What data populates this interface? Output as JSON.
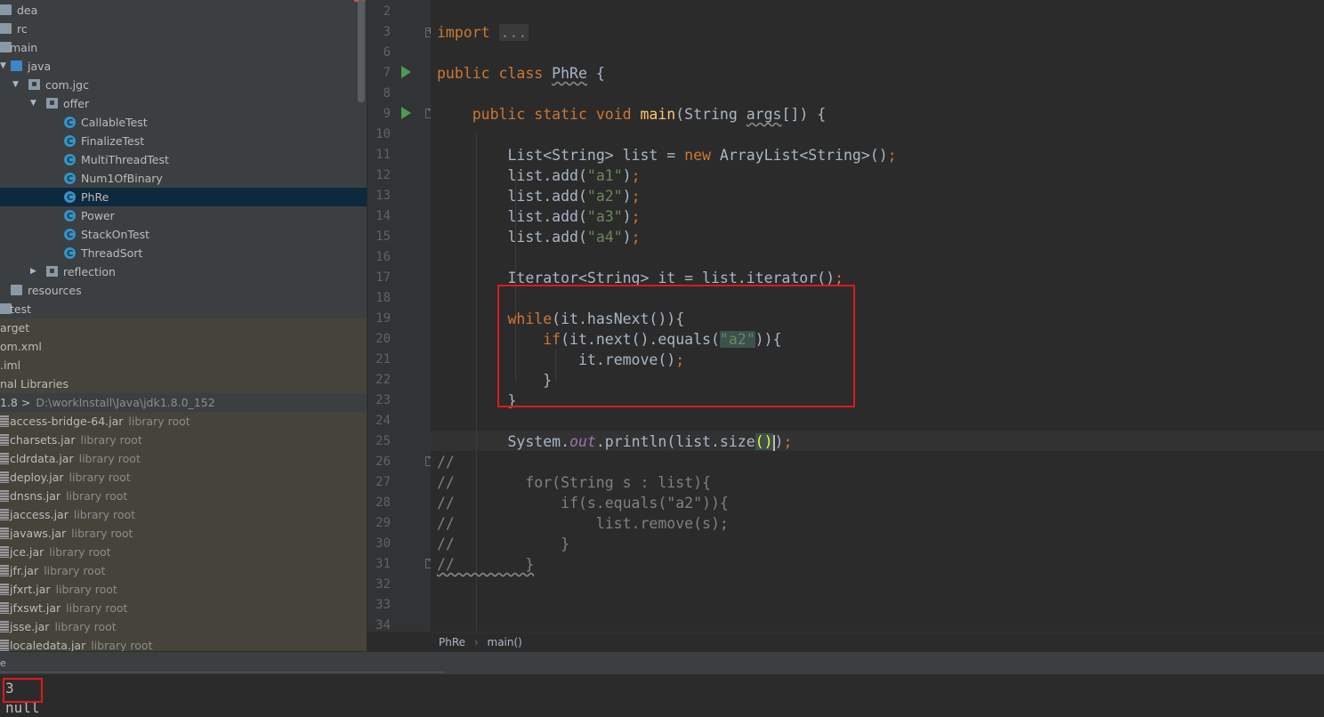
{
  "project_tree": {
    "items": [
      {
        "label": "dea",
        "icon": "folder-icon",
        "arrow": "",
        "indent": 0
      },
      {
        "label": "rc",
        "icon": "folder-icon",
        "arrow": "",
        "indent": 0
      },
      {
        "label": "main",
        "icon": "folder-icon",
        "arrow": "",
        "indent": 1
      },
      {
        "label": "java",
        "icon": "folder-icon",
        "arrow": "expanded",
        "indent": 2
      },
      {
        "label": "com.jgc",
        "icon": "package-icon",
        "arrow": "expanded",
        "indent": 3
      },
      {
        "label": "offer",
        "icon": "package-icon",
        "arrow": "expanded",
        "indent": 4
      },
      {
        "label": "CallableTest",
        "icon": "class-icon",
        "arrow": "",
        "indent": 5
      },
      {
        "label": "FinalizeTest",
        "icon": "class-icon",
        "arrow": "",
        "indent": 5
      },
      {
        "label": "MultiThreadTest",
        "icon": "class-icon",
        "arrow": "",
        "indent": 5
      },
      {
        "label": "Num1OfBinary",
        "icon": "class-icon",
        "arrow": "",
        "indent": 5
      },
      {
        "label": "PhRe",
        "icon": "class-icon",
        "arrow": "",
        "indent": 5
      },
      {
        "label": "Power",
        "icon": "class-icon",
        "arrow": "",
        "indent": 5
      },
      {
        "label": "StackOnTest",
        "icon": "class-icon",
        "arrow": "",
        "indent": 5
      },
      {
        "label": "ThreadSort",
        "icon": "class-icon",
        "arrow": "",
        "indent": 5
      },
      {
        "label": "reflection",
        "icon": "package-icon",
        "arrow": "collapsed",
        "indent": 4
      },
      {
        "label": "resources",
        "icon": "folder-icon",
        "arrow": "",
        "indent": 2
      },
      {
        "label": "test",
        "icon": "folder-icon",
        "arrow": "",
        "indent": 1
      },
      {
        "label": "arget",
        "icon": "",
        "arrow": "",
        "indent": 0
      },
      {
        "label": "om.xml",
        "icon": "",
        "arrow": "",
        "indent": 0
      },
      {
        "label": ".iml",
        "icon": "",
        "arrow": "",
        "indent": 0
      },
      {
        "label": "nal Libraries",
        "icon": "",
        "arrow": "",
        "indent": 0
      },
      {
        "label": "1.8 >",
        "icon": "",
        "arrow": "",
        "indent": 0,
        "sub": "D:\\workInstall\\Java\\jdk1.8.0_152"
      },
      {
        "label": "access-bridge-64.jar",
        "icon": "jar-icon",
        "arrow": "",
        "indent": 0,
        "sub": "library root"
      },
      {
        "label": "charsets.jar",
        "icon": "jar-icon",
        "arrow": "",
        "indent": 0,
        "sub": "library root"
      },
      {
        "label": "cldrdata.jar",
        "icon": "jar-icon",
        "arrow": "",
        "indent": 0,
        "sub": "library root"
      },
      {
        "label": "deploy.jar",
        "icon": "jar-icon",
        "arrow": "",
        "indent": 0,
        "sub": "library root"
      },
      {
        "label": "dnsns.jar",
        "icon": "jar-icon",
        "arrow": "",
        "indent": 0,
        "sub": "library root"
      },
      {
        "label": "jaccess.jar",
        "icon": "jar-icon",
        "arrow": "",
        "indent": 0,
        "sub": "library root"
      },
      {
        "label": "javaws.jar",
        "icon": "jar-icon",
        "arrow": "",
        "indent": 0,
        "sub": "library root"
      },
      {
        "label": "jce.jar",
        "icon": "jar-icon",
        "arrow": "",
        "indent": 0,
        "sub": "library root"
      },
      {
        "label": "jfr.jar",
        "icon": "jar-icon",
        "arrow": "",
        "indent": 0,
        "sub": "library root"
      },
      {
        "label": "jfxrt.jar",
        "icon": "jar-icon",
        "arrow": "",
        "indent": 0,
        "sub": "library root"
      },
      {
        "label": "jfxswt.jar",
        "icon": "jar-icon",
        "arrow": "",
        "indent": 0,
        "sub": "library root"
      },
      {
        "label": "jsse.jar",
        "icon": "jar-icon",
        "arrow": "",
        "indent": 0,
        "sub": "library root"
      },
      {
        "label": "localedata.jar",
        "icon": "jar-icon",
        "arrow": "",
        "indent": 0,
        "sub": "library root"
      }
    ],
    "selected": "PhRe"
  },
  "editor": {
    "line_numbers": [
      "2",
      "3",
      "6",
      "7",
      "8",
      "9",
      "10",
      "11",
      "12",
      "13",
      "14",
      "15",
      "16",
      "17",
      "18",
      "19",
      "20",
      "21",
      "22",
      "23",
      "24",
      "25",
      "26",
      "27",
      "28",
      "29",
      "30",
      "31",
      "32",
      "33",
      "34"
    ],
    "code": {
      "import_kw": "import",
      "import_fold": "...",
      "class_decl_kw": "public class",
      "class_name": "PhRe",
      "class_open": " {",
      "main_kw": "public static void",
      "main_name": "main",
      "main_sig_a": "(String ",
      "main_args": "args",
      "main_sig_b": "[]) {",
      "l11_a": "List<String> list = ",
      "l11_new": "new",
      "l11_b": " ArrayList<String>()",
      "semi": ";",
      "add_prefix": "list.add(",
      "add_a1": "\"a1\"",
      "add_a2": "\"a2\"",
      "add_a3": "\"a3\"",
      "add_a4": "\"a4\"",
      "add_suffix": ")",
      "l17": "Iterator<String> it = list.iterator()",
      "while_kw": "while",
      "while_rest": "(it.hasNext()){",
      "if_kw": "if",
      "if_rest_a": "(it.next().equals(",
      "if_str": "\"a2\"",
      "if_rest_b": ")){",
      "remove": "it.remove()",
      "close_inner": "}",
      "close_outer": "}",
      "println_a": "System.",
      "println_out": "out",
      "println_b": ".println(list.size",
      "println_paren": "()",
      "println_c": ")",
      "c26": "//",
      "c27": "//        for(String s : list){",
      "c28": "//            if(s.equals(\"a2\")){",
      "c29": "//                list.remove(s);",
      "c30": "//            }",
      "c31": "//        }"
    }
  },
  "breadcrumb": {
    "class": "PhRe",
    "separator": "›",
    "method": "main()"
  },
  "bottom_panel": {
    "tab_fragment": "e"
  },
  "console": {
    "lines": [
      "3",
      "null"
    ]
  },
  "colors": {
    "keyword": "#cc7832",
    "string": "#6a8759",
    "function": "#ffc66d",
    "comment": "#808080",
    "highlight_box": "#e0191b"
  }
}
